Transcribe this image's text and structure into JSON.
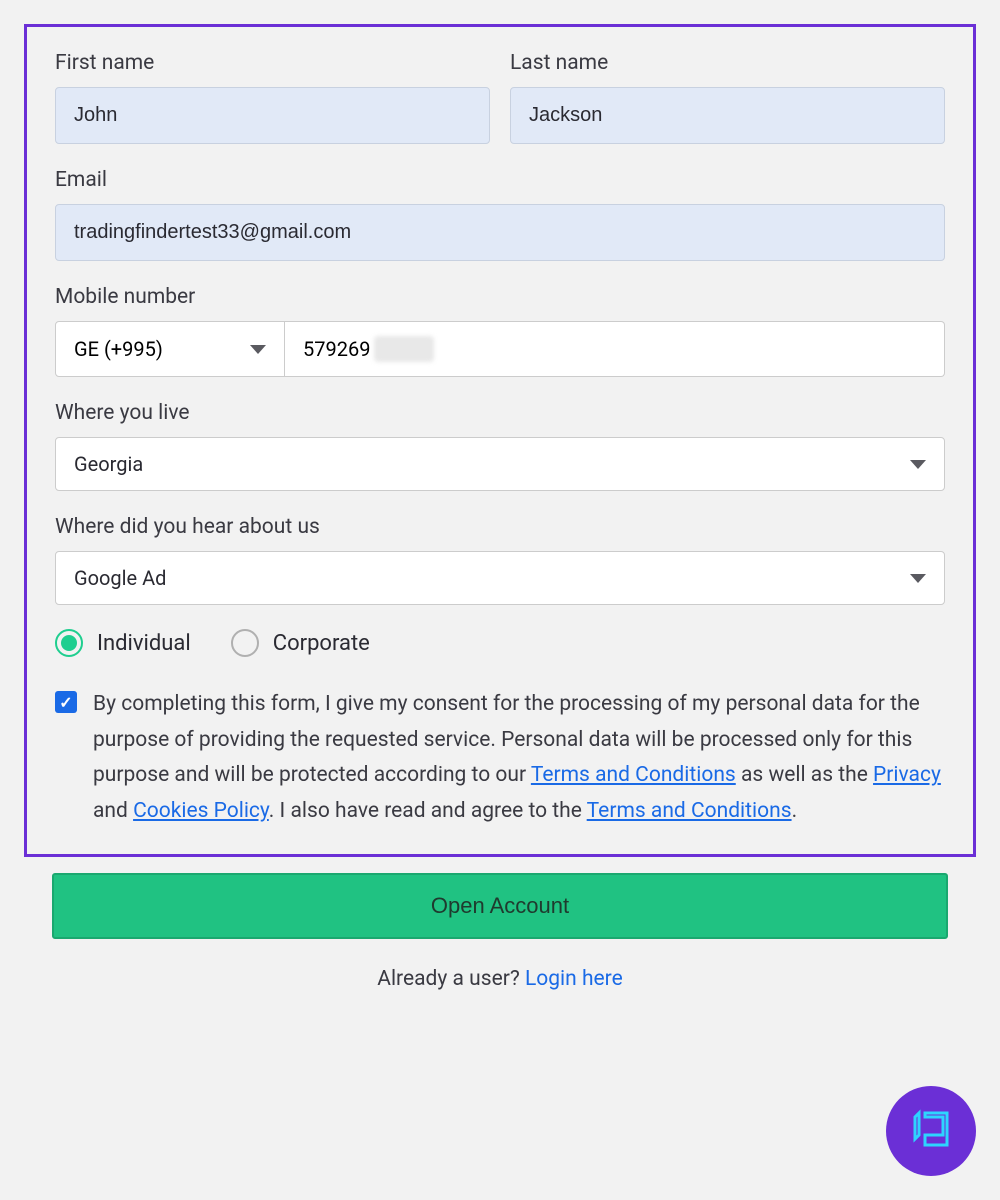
{
  "form": {
    "firstName": {
      "label": "First name",
      "value": "John"
    },
    "lastName": {
      "label": "Last name",
      "value": "Jackson"
    },
    "email": {
      "label": "Email",
      "value": "tradingfindertest33@gmail.com"
    },
    "mobile": {
      "label": "Mobile number",
      "countryCode": "GE (+995)",
      "number": "579269"
    },
    "country": {
      "label": "Where you live",
      "value": "Georgia"
    },
    "referral": {
      "label": "Where did you hear about us",
      "value": "Google Ad"
    },
    "accountType": {
      "individual": "Individual",
      "corporate": "Corporate"
    },
    "consent": {
      "part1": "By completing this form, I give my consent for the processing of my personal data for the purpose of providing the requested service. Personal data will be processed only for this purpose and will be protected according to our ",
      "link1": "Terms and Conditions",
      "part2": " as well as the ",
      "link2": "Privacy",
      "part3": " and ",
      "link3": "Cookies Policy",
      "part4": ". I also have read and agree to the ",
      "link4": "Terms and Conditions",
      "part5": "."
    },
    "submitLabel": "Open Account",
    "footer": {
      "prefix": "Already a user? ",
      "link": "Login here"
    }
  }
}
